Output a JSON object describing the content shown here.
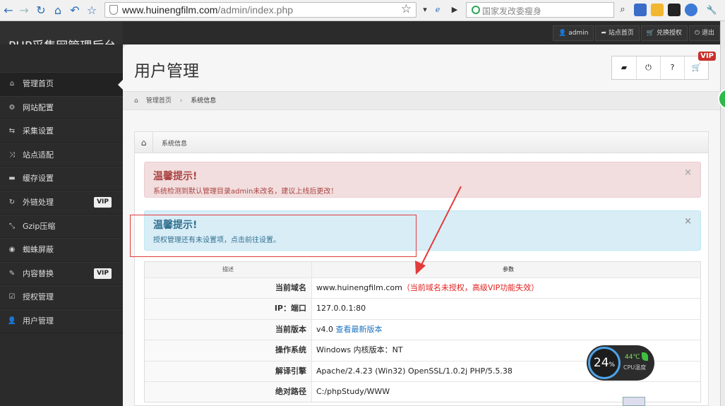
{
  "browser": {
    "url_host": "www.huinengfilm.com",
    "url_path": "/admin/index.php",
    "search_placeholder": "国家发改委瘦身"
  },
  "header": {
    "brand": "PHP采集网管理后台",
    "links": [
      "admin",
      "站点首页",
      "兑换授权",
      "退出"
    ]
  },
  "sidebar": {
    "items": [
      {
        "label": "管理首页",
        "icon": "home-icon",
        "vip": ""
      },
      {
        "label": "网站配置",
        "icon": "gear-icon",
        "vip": ""
      },
      {
        "label": "采集设置",
        "icon": "retweet-icon",
        "vip": ""
      },
      {
        "label": "站点适配",
        "icon": "shuffle-icon",
        "vip": ""
      },
      {
        "label": "缓存设置",
        "icon": "folder-icon",
        "vip": ""
      },
      {
        "label": "外链处理",
        "icon": "refresh-icon",
        "vip": "VIP"
      },
      {
        "label": "Gzip压缩",
        "icon": "compress-icon",
        "vip": ""
      },
      {
        "label": "蜘蛛屏蔽",
        "icon": "eye-slash-icon",
        "vip": ""
      },
      {
        "label": "内容替换",
        "icon": "pencil-icon",
        "vip": "VIP"
      },
      {
        "label": "授权管理",
        "icon": "check-square-icon",
        "vip": ""
      },
      {
        "label": "用户管理",
        "icon": "user-icon",
        "vip": ""
      }
    ]
  },
  "main": {
    "title": "用户管理",
    "vip_badge": "VIP",
    "breadcrumb": [
      "管理首页",
      "系统信息"
    ]
  },
  "panel": {
    "title": "系统信息",
    "alert_red": {
      "title": "温馨提示!",
      "message": "系统检测到默认管理目录admin未改名，建议上线后更改！"
    },
    "alert_blue": {
      "title": "温馨提示!",
      "message": "授权管理还有未设置项，点击前往设置。"
    },
    "table": {
      "headers": [
        "描述",
        "参数"
      ],
      "rows": [
        {
          "label": "当前域名",
          "value": "www.huinengfilm.com",
          "note": "（当前域名未授权，高级VIP功能失效）",
          "link": ""
        },
        {
          "label": "IP：端口",
          "value": "127.0.0.1:80",
          "note": "",
          "link": ""
        },
        {
          "label": "当前版本",
          "value": "v4.0",
          "note": "",
          "link": "查看最新版本"
        },
        {
          "label": "操作系统",
          "value": "Windows  内核版本：NT",
          "note": "",
          "link": ""
        },
        {
          "label": "解译引擎",
          "value": "Apache/2.4.23 (Win32) OpenSSL/1.0.2j PHP/5.5.38",
          "note": "",
          "link": ""
        },
        {
          "label": "绝对路径",
          "value": "C:/phpStudy/WWW",
          "note": "",
          "link": ""
        }
      ]
    }
  },
  "widget": {
    "cpu_percent": "24",
    "cpu_unit": "%",
    "temperature": "44℃",
    "label": "CPU温度"
  },
  "colors": {
    "alert_red": "#f2dede",
    "alert_blue": "#d9edf7",
    "highlight": "#e23b3b",
    "sidebar": "#2b2b2b"
  }
}
